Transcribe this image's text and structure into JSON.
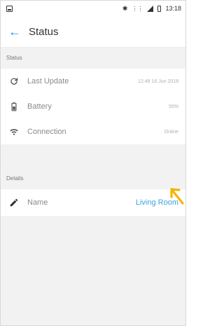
{
  "statusbar": {
    "time": "13:18"
  },
  "appbar": {
    "title": "Status"
  },
  "status_section": {
    "title": "Status",
    "rows": [
      {
        "icon": "refresh-icon",
        "label": "Last Update",
        "value": "12:48 16 Jun 2018"
      },
      {
        "icon": "battery-icon",
        "label": "Battery",
        "value": "55%"
      },
      {
        "icon": "wifi-icon",
        "label": "Connection",
        "value": "Online"
      }
    ]
  },
  "details_section": {
    "title": "Details",
    "rows": [
      {
        "icon": "pencil-icon",
        "label": "Name",
        "value": "Living Room"
      }
    ]
  },
  "colors": {
    "accent": "#2196f3",
    "link": "#3aa3e3",
    "annotation_arrow": "#f5b400"
  }
}
